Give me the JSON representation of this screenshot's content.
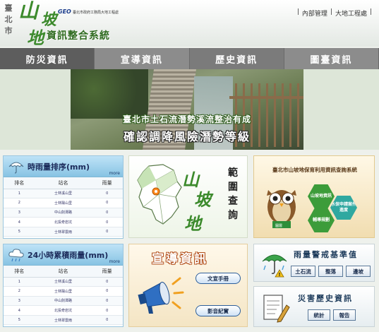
{
  "header": {
    "city": "臺北市",
    "logo_char1": "山",
    "logo_char2": "坡",
    "logo_char3": "地",
    "geo_mark": "GEO",
    "geo_line": "臺北市政府工務局大地工程處",
    "system_name": "資訊整合系統",
    "links": [
      "|",
      "內部管理",
      "|",
      "大地工程處",
      "|"
    ]
  },
  "nav": {
    "tabs": [
      "防災資訊",
      "宣導資訊",
      "歷史資訊",
      "圖臺資訊"
    ]
  },
  "banner": {
    "line1": "臺北市土石流潛勢溪流整治有成",
    "line2": "確認調降風險潛勢等級"
  },
  "rain_ranking": {
    "title": "時雨量排序(mm)",
    "more": "more",
    "columns": [
      "排名",
      "站名",
      "雨量"
    ],
    "rows": [
      [
        "1",
        "士林溪山里",
        "0"
      ],
      [
        "2",
        "士林陽山里",
        "0"
      ],
      [
        "3",
        "中山劍潭路",
        "0"
      ],
      [
        "4",
        "北投奇岩坑",
        "0"
      ],
      [
        "5",
        "士林翠雲雨",
        "0"
      ]
    ]
  },
  "rain_24h": {
    "title": "24小時累積雨量(mm)",
    "more": "more",
    "columns": [
      "排名",
      "站名",
      "雨量"
    ],
    "rows": [
      [
        "1",
        "士林溪山里",
        "0"
      ],
      [
        "2",
        "士林陽山里",
        "0"
      ],
      [
        "3",
        "中山劍潭路",
        "0"
      ],
      [
        "4",
        "北投奇岩坑",
        "0"
      ],
      [
        "5",
        "士林翠雲雨",
        "0"
      ]
    ]
  },
  "mountain_search": {
    "char1": "山",
    "char2": "坡",
    "char3": "地",
    "side": [
      "範",
      "圍",
      "查",
      "詢"
    ]
  },
  "slope_system": {
    "title": "臺北市山坡地保育利用資訊查詢系統",
    "hex1": "山坡地資訊",
    "hex2": "水保申請案件進度",
    "hex3": "輔導規劃",
    "owl_label": "圖層"
  },
  "promo": {
    "title": "宣導資訊",
    "manual": "文宣手冊",
    "video": "影音紀實"
  },
  "warning": {
    "title": "雨量警戒基準值",
    "buttons": [
      "土石流",
      "整落",
      "邊坡"
    ]
  },
  "history": {
    "title": "災害歷史資訊",
    "buttons": [
      "統計",
      "報告"
    ]
  },
  "colors": {
    "brand_green": "#3c8a2c",
    "nav_gray": "#7b7b7b",
    "rain_blue": "#87c3e3"
  }
}
